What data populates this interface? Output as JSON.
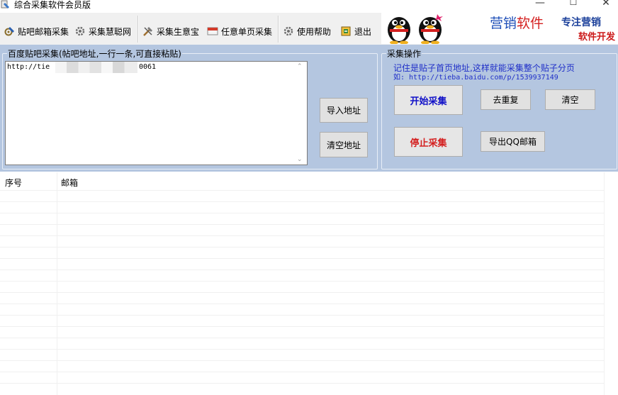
{
  "window": {
    "title": "综合采集软件会员版",
    "minimize_glyph": "—",
    "maximize_glyph": "☐",
    "close_glyph": "✕"
  },
  "toolbar": {
    "items": [
      {
        "label": "贴吧邮箱采集",
        "icon": "gear-pencil-icon"
      },
      {
        "label": "采集慧聪网",
        "icon": "gear-icon"
      },
      {
        "label": "采集生意宝",
        "icon": "tools-icon"
      },
      {
        "label": "任意单页采集",
        "icon": "card-icon"
      },
      {
        "label": "使用帮助",
        "icon": "gear-icon"
      },
      {
        "label": "退出",
        "icon": "exit-icon"
      }
    ]
  },
  "banner": {
    "text1_a": "营销",
    "text1_b": "软件",
    "text2": "专注营销",
    "text3": "软件开发"
  },
  "left_group": {
    "title": "百度贴吧采集(帖吧地址,一行一条,可直接粘贴)",
    "address_prefix": "http://tie",
    "address_suffix": "0061",
    "import_button": "导入地址",
    "clear_button": "清空地址"
  },
  "right_group": {
    "title": "采集操作",
    "hint_line1": "记住是贴子首页地址,这样就能采集整个贴子分页",
    "hint_line2": "如: http://tieba.baidu.com/p/1539937149",
    "start_button": "开始采集",
    "dedupe_button": "去重复",
    "clear_button": "清空",
    "stop_button": "停止采集",
    "export_button": "导出QQ邮箱"
  },
  "table": {
    "columns": [
      "序号",
      "邮箱"
    ]
  },
  "colors": {
    "panel_bg": "#b4c6e0",
    "start_text": "#1010c8",
    "stop_text": "#d42020",
    "hint_text": "#1f2fc8"
  }
}
